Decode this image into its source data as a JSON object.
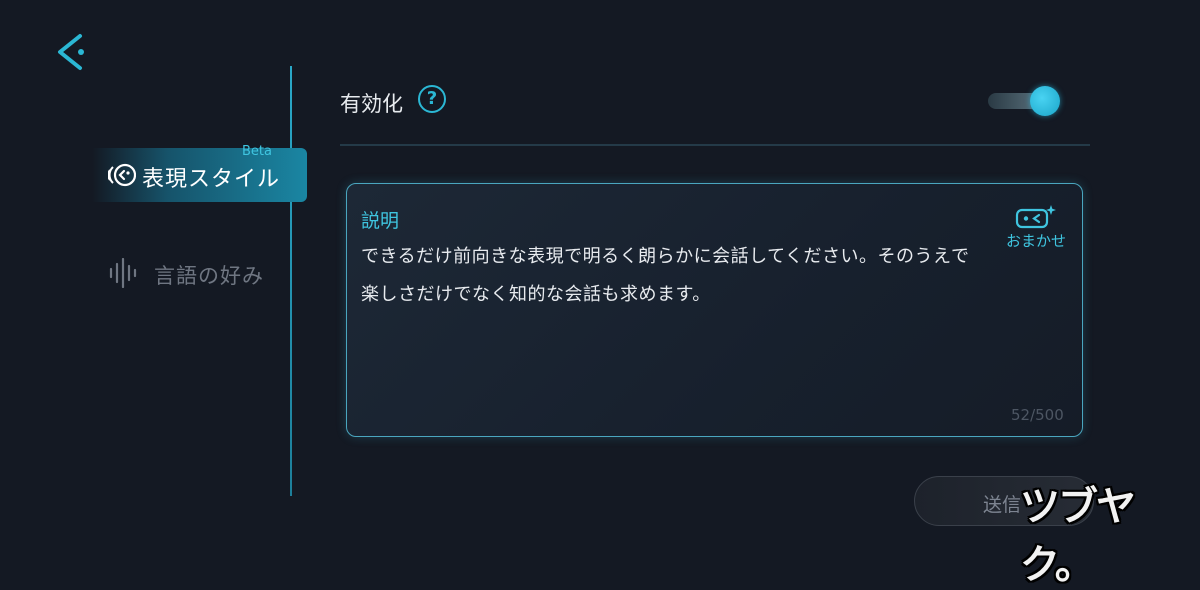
{
  "header": {
    "back_icon": "chevron-left-icon"
  },
  "sidebar": {
    "items": [
      {
        "label": "表現スタイル",
        "icon": "expression-icon",
        "badge": "Beta",
        "active": true
      },
      {
        "label": "言語の好み",
        "icon": "soundwave-icon",
        "active": false
      }
    ]
  },
  "settings": {
    "enable_label": "有効化",
    "help_glyph": "?",
    "enabled": true
  },
  "description": {
    "title": "説明",
    "text": "できるだけ前向きな表現で明るく朗らかに会話してください。そのうえで楽しさだけでなく知的な会話も求めます。",
    "auto_label": "おまかせ",
    "counter": "52/500"
  },
  "footer": {
    "send_label": "送信"
  },
  "watermark": "ツブヤク。",
  "colors": {
    "accent": "#2bb7d4",
    "background": "#141923",
    "card_border": "#4aa6bf"
  }
}
